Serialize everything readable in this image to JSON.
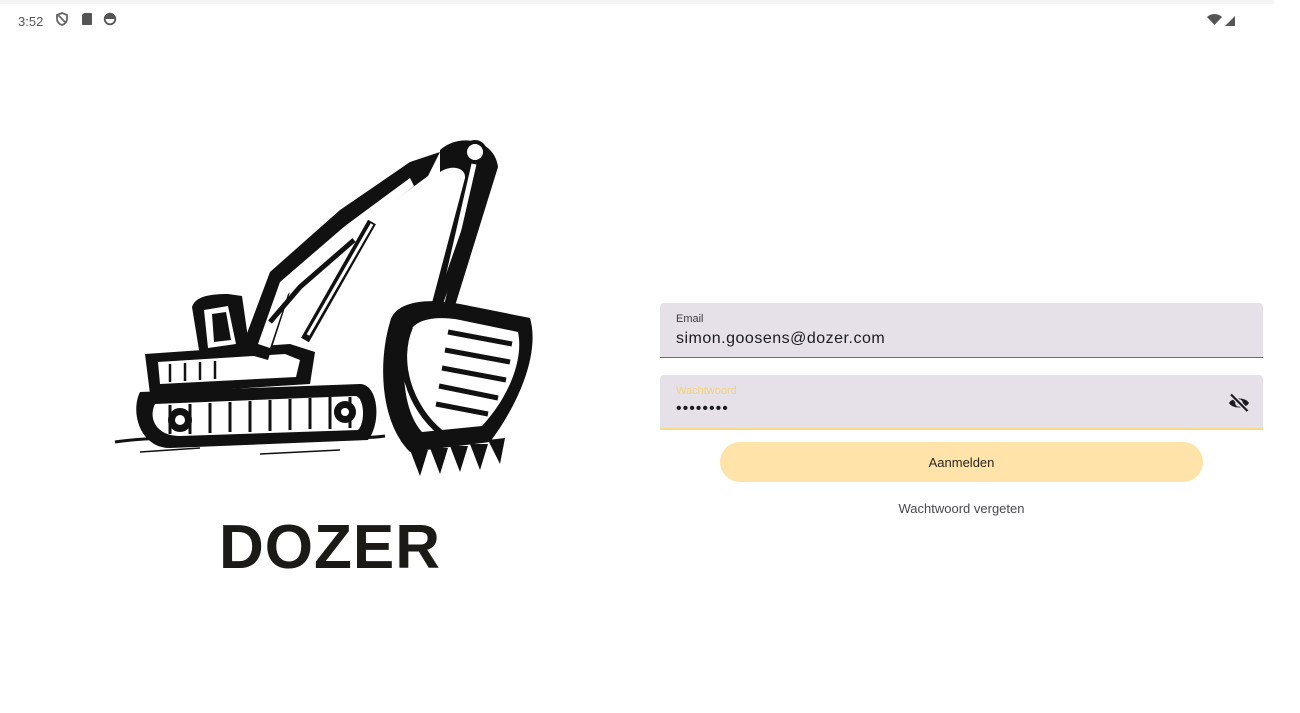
{
  "statusbar": {
    "time": "3:52",
    "left_icons": [
      "shield-icon",
      "sd-card-icon",
      "sync-icon"
    ],
    "right_icons": [
      "wifi-icon",
      "signal-icon"
    ]
  },
  "brand": {
    "name": "DOZER",
    "logo": "excavator-illustration"
  },
  "login": {
    "email_label": "Email",
    "email_value": "simon.goosens@dozer.com",
    "password_label": "Wachtwoord",
    "password_value": "••••••••",
    "toggle_icon": "visibility-off-icon",
    "submit_label": "Aanmelden",
    "forgot_label": "Wachtwoord vergeten"
  },
  "colors": {
    "field_bg": "#e6e0e9",
    "accent": "#f5d98a",
    "button_bg": "#ffe3a8"
  }
}
